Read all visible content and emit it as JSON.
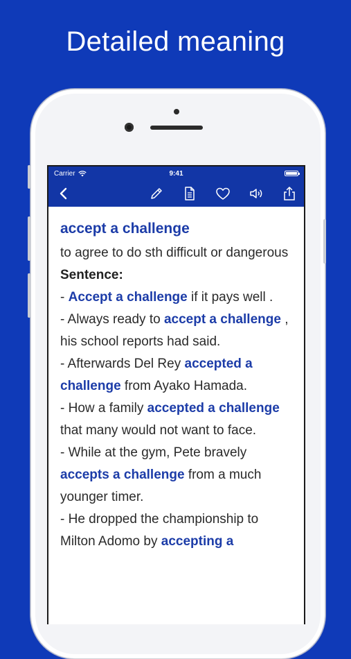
{
  "promo": {
    "headline": "Detailed meaning"
  },
  "status_bar": {
    "carrier": "Carrier",
    "time": "9:41"
  },
  "toolbar": {
    "icons": [
      "back-icon",
      "pencil-icon",
      "document-icon",
      "heart-icon",
      "speaker-icon",
      "share-icon"
    ]
  },
  "entry": {
    "term": "accept a challenge",
    "definition": "to agree to do sth difficult or dangerous",
    "sentence_label": "Sentence:",
    "sentences": [
      {
        "prefix": "- ",
        "highlight": "Accept a challenge",
        "suffix": " if it pays well ."
      },
      {
        "prefix": "- Always ready to ",
        "highlight": "accept a challenge",
        "suffix": " , his school reports had said."
      },
      {
        "prefix": "- Afterwards Del Rey ",
        "highlight": "accepted a challenge",
        "suffix": " from Ayako Hamada."
      },
      {
        "prefix": "- How a family ",
        "highlight": "accepted a challenge",
        "suffix": " that many would not want to face."
      },
      {
        "prefix": "- While at the gym, Pete bravely ",
        "highlight": "accepts a challenge",
        "suffix": " from a much younger timer."
      },
      {
        "prefix": "- He dropped the championship to Milton Adomo by ",
        "highlight": "accepting a",
        "suffix": ""
      }
    ]
  },
  "colors": {
    "brand_blue": "#0f3ab8",
    "nav_blue": "#1236a6",
    "highlight": "#1c3ca8"
  }
}
